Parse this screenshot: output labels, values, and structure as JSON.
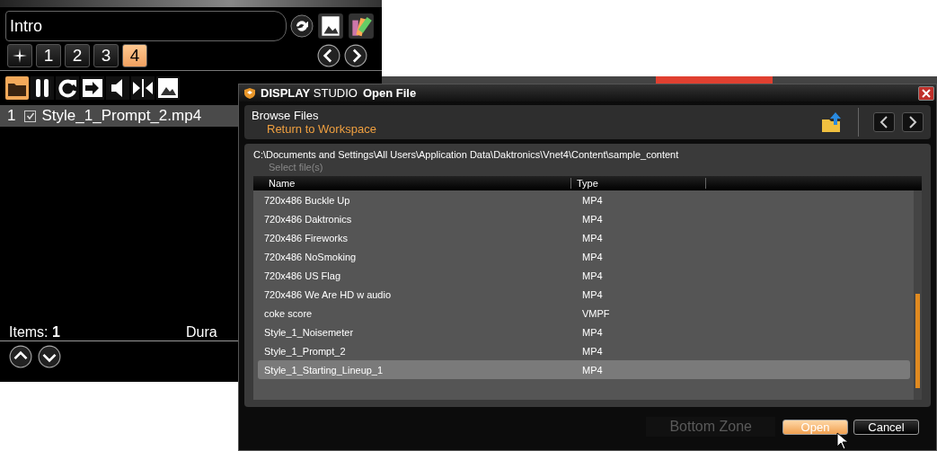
{
  "playlist": {
    "title": "Intro",
    "pages": [
      {
        "label": "1",
        "selected": false
      },
      {
        "label": "2",
        "selected": false
      },
      {
        "label": "3",
        "selected": false
      },
      {
        "label": "4",
        "selected": true
      }
    ],
    "items": [
      {
        "number": "1",
        "checked": true,
        "name": "Style_1_Prompt_2.mp4",
        "selected": true
      }
    ],
    "items_label": "Items:",
    "items_count": "1",
    "duration_label": "Dura"
  },
  "dialog": {
    "brand": "DISPLAY",
    "brand_suffix": "STUDIO",
    "title": "Open File",
    "heading": "Browse Files",
    "link": "Return to Workspace",
    "path": "C:\\Documents and Settings\\All Users\\Application Data\\Daktronics\\Vnet4\\Content\\sample_content",
    "hint": "Select file(s)",
    "columns": [
      "Name",
      "Type"
    ],
    "rows": [
      {
        "name": "720x486 Buckle Up",
        "type": "MP4",
        "selected": false
      },
      {
        "name": "720x486 Daktronics",
        "type": "MP4",
        "selected": false
      },
      {
        "name": "720x486 Fireworks",
        "type": "MP4",
        "selected": false
      },
      {
        "name": "720x486 NoSmoking",
        "type": "MP4",
        "selected": false
      },
      {
        "name": "720x486 US Flag",
        "type": "MP4",
        "selected": false
      },
      {
        "name": "720x486 We Are HD w audio",
        "type": "MP4",
        "selected": false
      },
      {
        "name": "coke score",
        "type": "VMPF",
        "selected": false
      },
      {
        "name": "Style_1_Noisemeter",
        "type": "MP4",
        "selected": false
      },
      {
        "name": "Style_1_Prompt_2",
        "type": "MP4",
        "selected": false
      },
      {
        "name": "Style_1_Starting_Lineup_1",
        "type": "MP4",
        "selected": true
      }
    ],
    "background_label": "Bottom Zone",
    "buttons": [
      "Open",
      "Cancel"
    ]
  }
}
